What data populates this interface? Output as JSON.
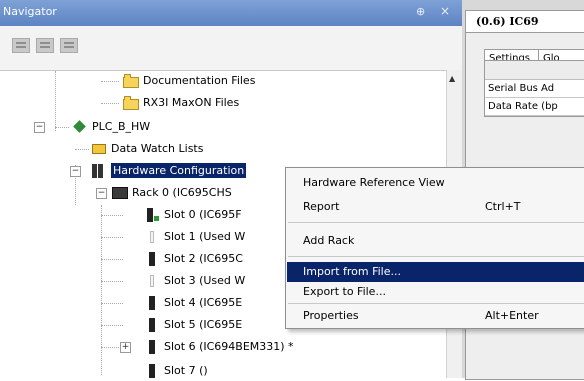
{
  "navigator": {
    "title": "Navigator",
    "pin_glyph": "⊕",
    "close_glyph": "×",
    "tree": [
      {
        "label": "Documentation Files",
        "icon": "folder-icon"
      },
      {
        "label": "RX3I MaxON Files",
        "icon": "folder-icon"
      },
      {
        "label": "PLC_B_HW",
        "icon": "plc-target-icon"
      },
      {
        "label": "Data Watch Lists",
        "icon": "data-watch-icon"
      },
      {
        "label": "Hardware Configuration",
        "icon": "hardware-config-icon"
      },
      {
        "label": "Rack 0 (IC695CHS",
        "icon": "rack-icon"
      },
      {
        "label": "Slot 0 (IC695F",
        "icon": "cpu-module-icon"
      },
      {
        "label": "Slot 1 (Used W",
        "icon": "empty-slot-icon"
      },
      {
        "label": "Slot 2 (IC695C",
        "icon": "module-icon"
      },
      {
        "label": "Slot 3 (Used W",
        "icon": "empty-slot-icon"
      },
      {
        "label": "Slot 4 (IC695E",
        "icon": "module-icon"
      },
      {
        "label": "Slot 5 (IC695E",
        "icon": "module-icon"
      },
      {
        "label": "Slot 6 (IC694BEM331) *",
        "icon": "module-icon"
      },
      {
        "label": "Slot 7 ()",
        "icon": "module-icon"
      }
    ]
  },
  "context_menu": {
    "items": [
      {
        "label": "Hardware Reference View",
        "shortcut": ""
      },
      {
        "label": "Report",
        "shortcut": "Ctrl+T"
      },
      {
        "label": "Add Rack",
        "shortcut": ""
      },
      {
        "label": "Import from File...",
        "shortcut": ""
      },
      {
        "label": "Export to File...",
        "shortcut": ""
      },
      {
        "label": "Properties",
        "shortcut": "Alt+Enter"
      }
    ],
    "highlighted": "Import from File..."
  },
  "inspector": {
    "tab_title": "(0.6) IC69",
    "subtabs": [
      "Settings",
      "Glo"
    ],
    "rows": [
      "Serial Bus Ad",
      "Data Rate (bp"
    ]
  },
  "colors": {
    "selection": "#0a246a",
    "titlebar": "#5d83c3"
  }
}
